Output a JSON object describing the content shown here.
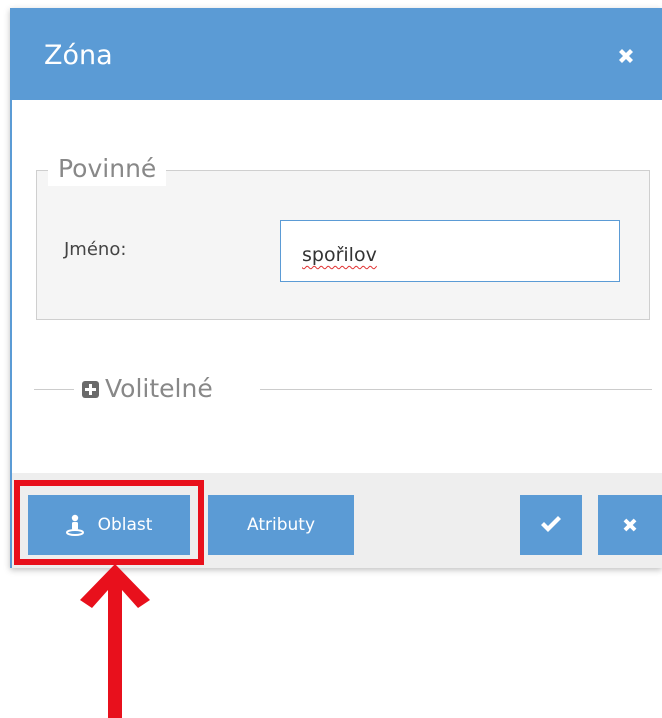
{
  "dialog": {
    "title": "Zóna",
    "close_icon": "close-icon",
    "accent_color": "#5b9bd5"
  },
  "required_section": {
    "legend": "Povinné",
    "name_label": "Jméno:",
    "name_value": "spořilov"
  },
  "optional_section": {
    "legend": "Volitelné",
    "toggle_icon": "plus-square-icon",
    "expanded": false
  },
  "footer": {
    "oblast_label": "Oblast",
    "oblast_icon": "person-pin-icon",
    "atributy_label": "Atributy",
    "confirm_icon": "check-icon",
    "cancel_icon": "close-icon"
  },
  "annotation": {
    "color": "#e8101c",
    "highlight_target": "Oblast"
  }
}
